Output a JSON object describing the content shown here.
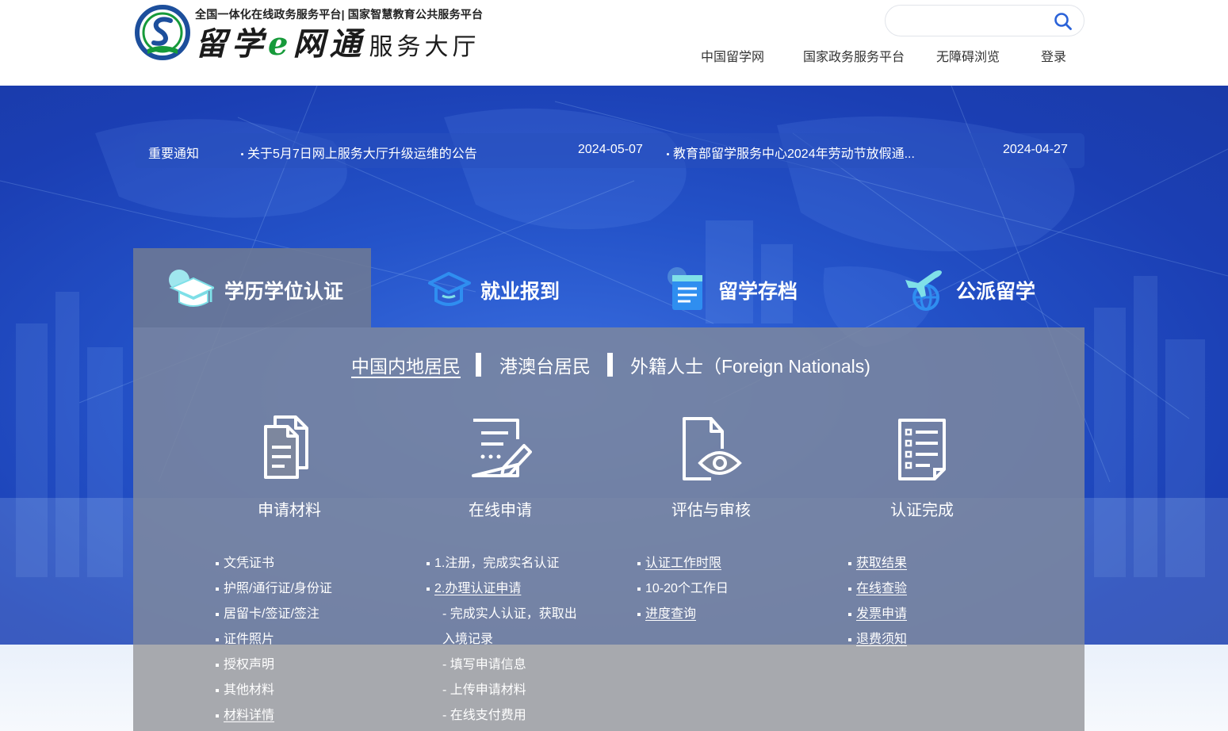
{
  "header": {
    "tagline": "全国一体化在线政务服务平台| 国家智慧教育公共服务平台",
    "title_main_1": "留学",
    "title_e": "e",
    "title_main_2": "网通",
    "title_sub": "服务大厅",
    "search": {
      "value": "",
      "placeholder": ""
    },
    "nav": [
      "中国留学网",
      "国家政务服务平台",
      "无障碍浏览",
      "登录"
    ]
  },
  "notice": {
    "label": "重要通知",
    "items": [
      {
        "title": "关于5月7日网上服务大厅升级运维的公告",
        "date": "2024-05-07"
      },
      {
        "title": "教育部留学服务中心2024年劳动节放假通...",
        "date": "2024-04-27"
      }
    ]
  },
  "service_tabs": [
    {
      "label": "学历学位认证",
      "icon": "graduation-cap-icon",
      "active": true
    },
    {
      "label": "就业报到",
      "icon": "mortarboard-outline-icon",
      "active": false
    },
    {
      "label": "留学存档",
      "icon": "archive-file-icon",
      "active": false
    },
    {
      "label": "公派留学",
      "icon": "plane-globe-icon",
      "active": false
    }
  ],
  "sub_tabs": [
    {
      "label": "中国内地居民",
      "active": true
    },
    {
      "label": "港澳台居民",
      "active": false
    },
    {
      "label": "外籍人士（Foreign Nationals)",
      "active": false
    }
  ],
  "steps": [
    {
      "label": "申请材料",
      "icon": "documents-icon"
    },
    {
      "label": "在线申请",
      "icon": "edit-form-icon"
    },
    {
      "label": "评估与审核",
      "icon": "review-eye-icon"
    },
    {
      "label": "认证完成",
      "icon": "checklist-icon"
    }
  ],
  "step_links": [
    [
      {
        "text": "文凭证书",
        "bullet": true,
        "underline": false
      },
      {
        "text": "护照/通行证/身份证",
        "bullet": true,
        "underline": false
      },
      {
        "text": "居留卡/签证/签注",
        "bullet": true,
        "underline": false
      },
      {
        "text": "证件照片",
        "bullet": true,
        "underline": false
      },
      {
        "text": "授权声明",
        "bullet": true,
        "underline": false
      },
      {
        "text": "其他材料",
        "bullet": true,
        "underline": false
      },
      {
        "text": "材料详情",
        "bullet": true,
        "underline": true
      }
    ],
    [
      {
        "text": "1.注册，完成实名认证",
        "bullet": true,
        "underline": false
      },
      {
        "text": "2.办理认证申请",
        "bullet": true,
        "underline": true,
        "prefix": "2."
      },
      {
        "text": "- 完成实人认证，获取出",
        "bullet": false,
        "underline": false
      },
      {
        "text": "入境记录",
        "bullet": false,
        "underline": false
      },
      {
        "text": "- 填写申请信息",
        "bullet": false,
        "underline": false
      },
      {
        "text": "- 上传申请材料",
        "bullet": false,
        "underline": false
      },
      {
        "text": "- 在线支付费用",
        "bullet": false,
        "underline": false
      }
    ],
    [
      {
        "text": "认证工作时限",
        "bullet": true,
        "underline": true
      },
      {
        "text": "10-20个工作日",
        "bullet": true,
        "underline": false
      },
      {
        "text": "进度查询",
        "bullet": true,
        "underline": true
      }
    ],
    [
      {
        "text": "获取结果",
        "bullet": true,
        "underline": true
      },
      {
        "text": "在线查验",
        "bullet": true,
        "underline": true
      },
      {
        "text": "发票申请",
        "bullet": true,
        "underline": true
      },
      {
        "text": "退费须知",
        "bullet": true,
        "underline": true
      }
    ]
  ],
  "colors": {
    "hero_blue": "#2453c9",
    "panel_gray": "#7d879e",
    "logo_green": "#169a3a",
    "logo_blue": "#1d4f9c",
    "tab_icon_teal": "#7fe0e8"
  }
}
